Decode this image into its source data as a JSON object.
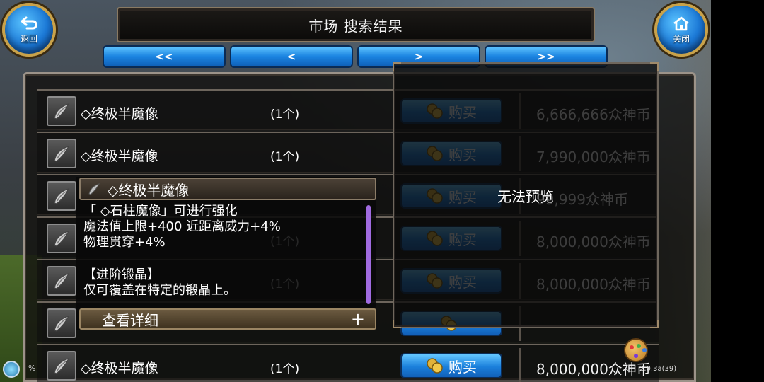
{
  "header": {
    "title": "市场 搜索结果",
    "back_label": "返回",
    "close_label": "关闭"
  },
  "pager": {
    "first": "<<",
    "prev": "<",
    "next": ">",
    "last": ">>"
  },
  "rows": [
    {
      "name": "◇终极半魔像",
      "qty": "(1个)",
      "buy": "购买",
      "price": "6,666,666众神币"
    },
    {
      "name": "◇终极半魔像",
      "qty": "(1个)",
      "buy": "购买",
      "price": "7,990,000众神币"
    },
    {
      "name": "",
      "qty": "",
      "buy": "购买",
      "price": "99,999众神币"
    },
    {
      "name": "",
      "qty": "(1个)",
      "buy": "购买",
      "price": "8,000,000众神币"
    },
    {
      "name": "",
      "qty": "(1个)",
      "buy": "购买",
      "price": "8,000,000众神币"
    },
    {
      "name": "",
      "qty": "",
      "buy": "",
      "price": ""
    },
    {
      "name": "◇终极半魔像",
      "qty": "(1个)",
      "buy": "购买",
      "price": "8,000,000众神币"
    }
  ],
  "preview": {
    "text": "无法预览"
  },
  "tooltip": {
    "title": "◇终极半魔像",
    "line1": "「 ◇石柱魔像」可进行强化",
    "line2": "魔法值上限+400 近距离威力+4%",
    "line3": "物理贯穿+4%",
    "line4": "【进阶锻晶】",
    "line5": "仅可覆盖在特定的锻晶上。",
    "footer": "查看详细",
    "footer_plus": "+"
  },
  "footer": {
    "version": "2.0.3a(39)",
    "pct": "%"
  },
  "colors": {
    "accent_blue": "#1a83e0",
    "frame_gold": "#c9a24a",
    "scrollbar_purple": "#a06be0"
  }
}
